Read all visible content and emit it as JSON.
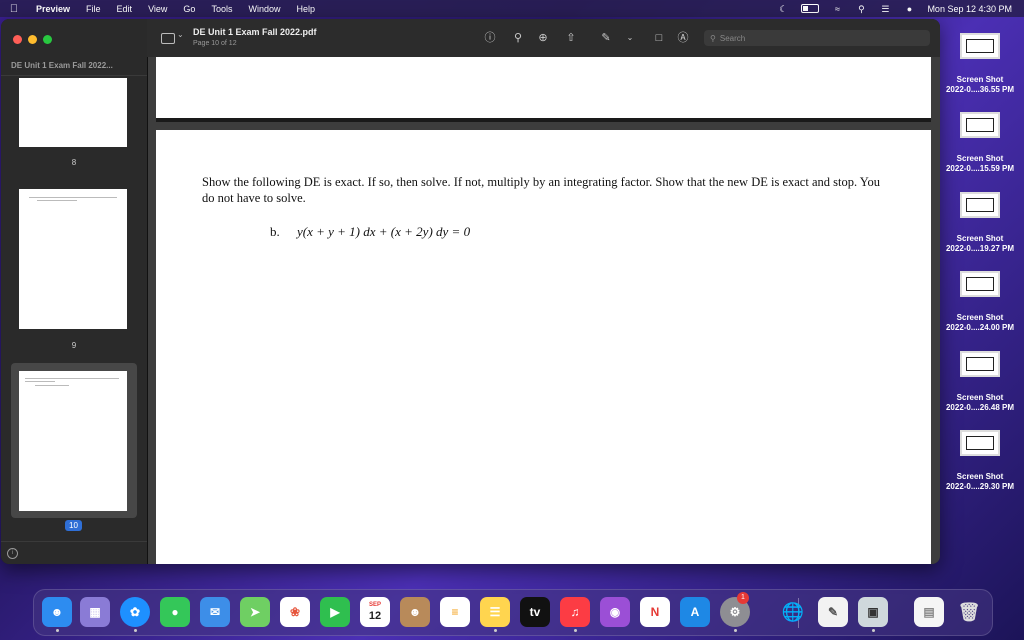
{
  "menubar": {
    "app": "Preview",
    "items": [
      "File",
      "Edit",
      "View",
      "Go",
      "Tools",
      "Window",
      "Help"
    ],
    "clock": "Mon Sep 12  4:30 PM"
  },
  "window": {
    "sidebar": {
      "title": "DE Unit 1 Exam Fall 2022...",
      "page_labels": [
        "8",
        "9",
        "10"
      ],
      "selected_page": "10"
    },
    "toolbar": {
      "doc_title": "DE Unit 1 Exam Fall 2022.pdf",
      "doc_subtitle": "Page 10 of 12",
      "search_placeholder": "Search"
    },
    "document": {
      "question": "Show the following DE is exact. If so, then solve. If not, multiply by an integrating factor. Show that the new DE is exact and stop. You do not have to solve.",
      "item_label": "b.",
      "equation": "y(x + y + 1) dx + (x + 2y) dy = 0"
    }
  },
  "desktop": {
    "files": [
      {
        "line1": "Screen Shot",
        "line2": "2022-0....36.55 PM"
      },
      {
        "line1": "Screen Shot",
        "line2": "2022-0....15.59 PM"
      },
      {
        "line1": "Screen Shot",
        "line2": "2022-0....19.27 PM"
      },
      {
        "line1": "Screen Shot",
        "line2": "2022-0....24.00 PM"
      },
      {
        "line1": "Screen Shot",
        "line2": "2022-0....26.48 PM"
      },
      {
        "line1": "Screen Shot",
        "line2": "2022-0....29.30 PM"
      }
    ]
  },
  "dock": {
    "calendar_month": "SEP",
    "calendar_day": "12",
    "tv_label": "tv",
    "settings_badge": "1"
  },
  "colors": {
    "accent": "#2f6fd6",
    "close": "#ff5f57",
    "minimize": "#febc2e",
    "zoom": "#28c840"
  }
}
